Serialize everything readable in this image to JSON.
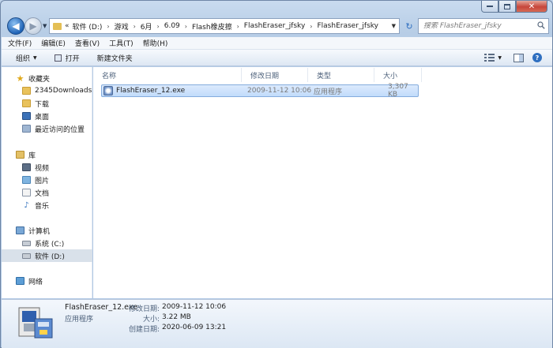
{
  "window": {
    "caption": {
      "minimize": "minimize",
      "maximize": "maximize",
      "close": "✕"
    }
  },
  "nav": {
    "back_glyph": "◀",
    "forward_glyph": "▶",
    "history_glyph": "▼"
  },
  "address": {
    "more": "«",
    "crumbs": [
      "软件 (D:)",
      "游戏",
      "6月",
      "6.09",
      "Flash橡皮擦",
      "FlashEraser_jfsky",
      "FlashEraser_jfsky"
    ],
    "separator": "›",
    "dropdown": "▼",
    "refresh_glyph": "↻"
  },
  "search": {
    "placeholder": "搜索 FlashEraser_jfsky"
  },
  "menu": [
    "文件(F)",
    "编辑(E)",
    "查看(V)",
    "工具(T)",
    "帮助(H)"
  ],
  "toolbar": {
    "organize": "组织",
    "organize_dropdown": "▼",
    "open": "打开",
    "new_folder": "新建文件夹",
    "view_dropdown": "▼",
    "help_glyph": "?"
  },
  "navpane": {
    "favorites": "收藏夹",
    "favorites_items": [
      "2345Downloads",
      "下载",
      "桌面",
      "最近访问的位置"
    ],
    "libraries": "库",
    "library_items": [
      "视频",
      "图片",
      "文档",
      "音乐"
    ],
    "computer": "计算机",
    "drives": [
      "系统 (C:)",
      "软件 (D:)"
    ],
    "network": "网络",
    "music_glyph": "♪",
    "star_glyph": "★"
  },
  "columns": [
    "名称",
    "修改日期",
    "类型",
    "大小"
  ],
  "files": [
    {
      "name": "FlashEraser_12.exe",
      "modified": "2009-11-12 10:06",
      "type": "应用程序",
      "size": "3,307 KB"
    }
  ],
  "details": {
    "name": "FlashEraser_12.exe",
    "type": "应用程序",
    "modified_label": "修改日期:",
    "modified": "2009-11-12 10:06",
    "size_label": "大小:",
    "size": "3.22 MB",
    "created_label": "创建日期:",
    "created": "2020-06-09 13:21"
  },
  "colors": {
    "selection": "#c1dcfb",
    "accent": "#2f6fc0"
  }
}
